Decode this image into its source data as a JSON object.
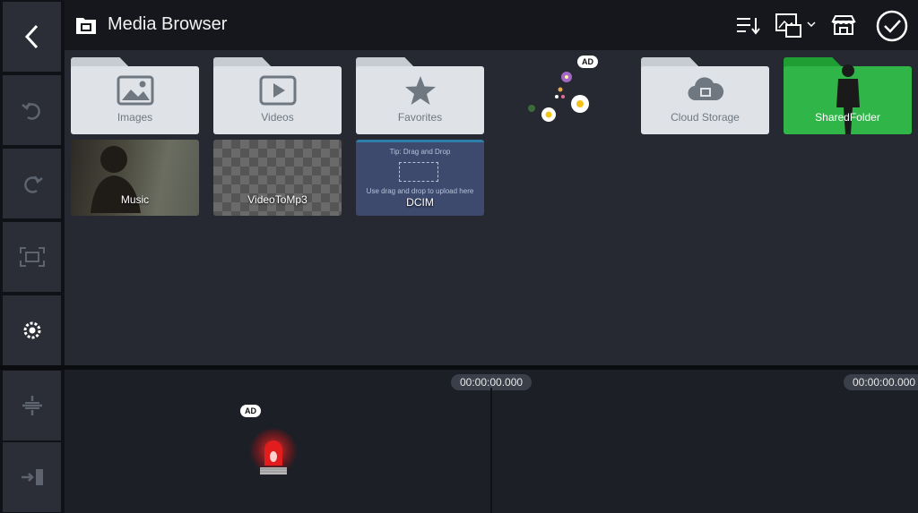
{
  "header": {
    "title": "Media Browser"
  },
  "sidebar": {
    "buttons": [
      "back-icon",
      "undo-icon",
      "redo-icon",
      "crop-icon",
      "settings-icon",
      "split-icon",
      "export-icon"
    ]
  },
  "header_icons": [
    "sort-icon",
    "media-type-icon",
    "store-icon",
    "done-icon"
  ],
  "folders": [
    {
      "label": "Images",
      "icon": "image-icon"
    },
    {
      "label": "Videos",
      "icon": "video-icon"
    },
    {
      "label": "Favorites",
      "icon": "star-icon"
    },
    {
      "label": "Cloud Storage",
      "icon": "cloud-icon"
    },
    {
      "label": "SharedFolder",
      "icon": "person-icon"
    }
  ],
  "tiles": [
    {
      "label": "Music"
    },
    {
      "label": "VideoToMp3"
    },
    {
      "label": "DCIM",
      "tip": "Tip: Drag and Drop",
      "sub": "Use drag and drop to upload here"
    }
  ],
  "ads": {
    "top": "AD",
    "timeline": "AD"
  },
  "timeline": {
    "left_time": "00:00:00.000",
    "right_time": "00:00:00.000"
  },
  "colors": {
    "accent_green": "#2fb548",
    "panel": "#262932",
    "folder": "#dfe3e8"
  }
}
